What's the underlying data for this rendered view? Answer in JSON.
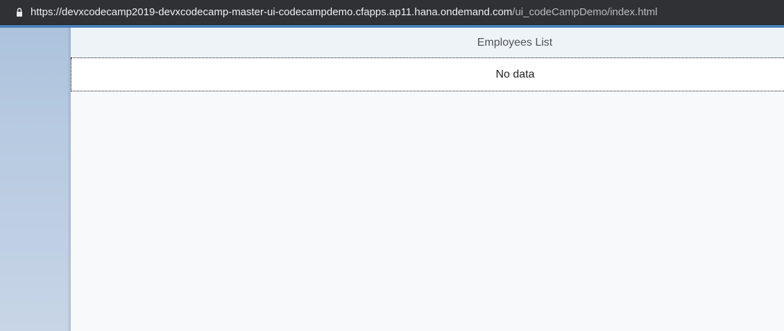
{
  "browser": {
    "url_main": "https://devxcodecamp2019-devxcodecamp-master-ui-codecampdemo.cfapps.ap11.hana.ondemand.com",
    "url_path": "/ui_codeCampDemo/index.html",
    "lock_icon": "lock-icon",
    "colors": {
      "bar": "#2f3134",
      "url_main": "#eef1f4",
      "url_path": "#b8bdc3"
    }
  },
  "page": {
    "colors": {
      "accent_strip": "#4a7fb4",
      "left_panel": "#b7cae1",
      "content": "#f8f9fa",
      "header": "#eef3f8"
    }
  },
  "table": {
    "title": "Employees List",
    "empty_text": "No data"
  }
}
